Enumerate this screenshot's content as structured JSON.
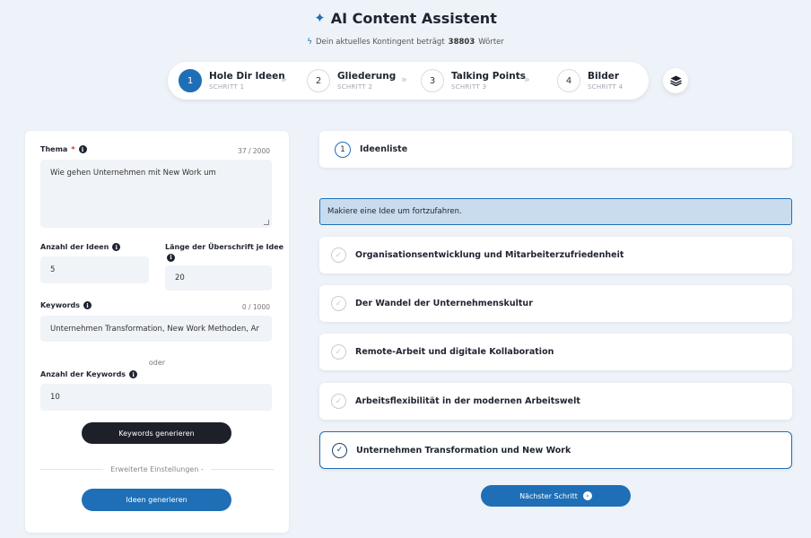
{
  "header": {
    "title": "AI Content Assistent",
    "quota_prefix": "Dein aktuelles Kontingent beträgt",
    "quota_value": "38803",
    "quota_suffix": "Wörter"
  },
  "steps": [
    {
      "num": "1",
      "name": "Hole Dir Ideen",
      "sub": "SCHRITT 1",
      "active": true
    },
    {
      "num": "2",
      "name": "Gliederung",
      "sub": "SCHRITT 2",
      "active": false
    },
    {
      "num": "3",
      "name": "Talking Points",
      "sub": "SCHRITT 3",
      "active": false
    },
    {
      "num": "4",
      "name": "Bilder",
      "sub": "SCHRITT 4",
      "active": false
    }
  ],
  "form": {
    "thema_label": "Thema",
    "thema_required": "*",
    "thema_counter": "37 / 2000",
    "thema_value": "Wie gehen Unternehmen mit New Work um",
    "anzahl_ideen_label": "Anzahl der Ideen",
    "anzahl_ideen_value": "5",
    "laenge_label": "Länge der Überschrift je Idee",
    "laenge_value": "20",
    "keywords_label": "Keywords",
    "keywords_counter": "0 / 1000",
    "keywords_value": "Unternehmen Transformation, New Work Methoden, Ar",
    "oder": "oder",
    "anzahl_keywords_label": "Anzahl der Keywords",
    "anzahl_keywords_value": "10",
    "keywords_button": "Keywords generieren",
    "advanced": "Erweiterte Einstellungen -",
    "generate_button": "Ideen generieren"
  },
  "ideas": {
    "num": "1",
    "title": "Ideenliste",
    "hint": "Makiere eine Idee um fortzufahren.",
    "items": [
      {
        "label": "Organisationsentwicklung und Mitarbeiterzufriedenheit",
        "selected": false
      },
      {
        "label": "Der Wandel der Unternehmenskultur",
        "selected": false
      },
      {
        "label": "Remote-Arbeit und digitale Kollaboration",
        "selected": false
      },
      {
        "label": "Arbeitsflexibilität in der modernen Arbeitswelt",
        "selected": false
      },
      {
        "label": "Unternehmen Transformation und New Work",
        "selected": true
      }
    ],
    "next_button": "Nächster Schritt"
  },
  "colors": {
    "accent": "#1f6fb7",
    "dark_button": "#1d2029",
    "background": "#eef3f9"
  }
}
